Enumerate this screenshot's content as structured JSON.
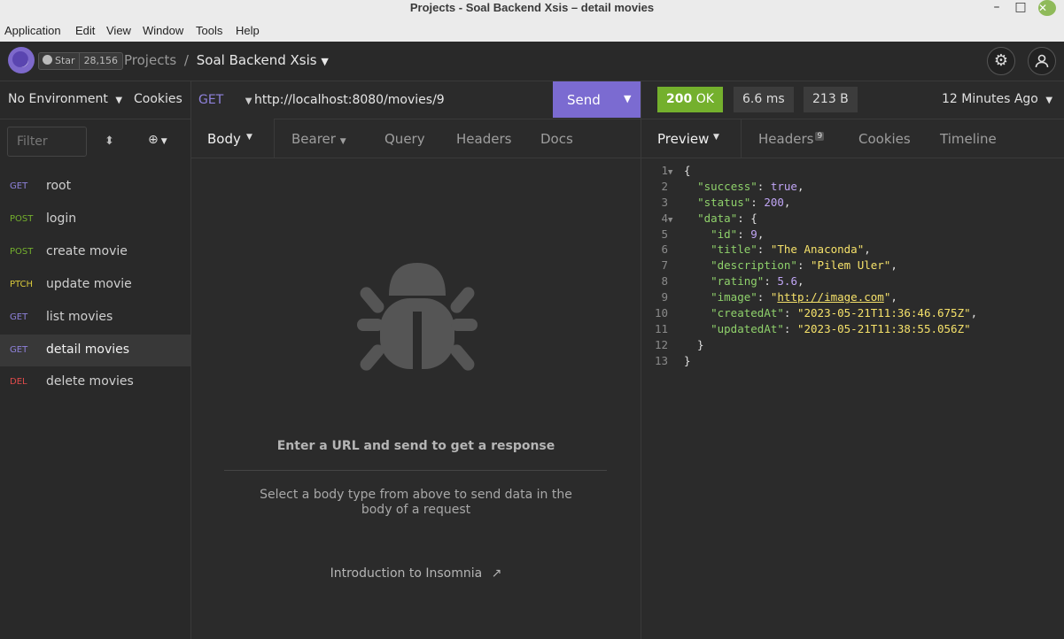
{
  "window": {
    "title": "Projects - Soal Backend Xsis – detail movies",
    "minimize": "–",
    "maximize": "□",
    "close": "✕"
  },
  "menubar": [
    "Application",
    "Edit",
    "View",
    "Window",
    "Tools",
    "Help"
  ],
  "header": {
    "star_label": "Star",
    "star_count": "28,156",
    "breadcrumb_root": "Projects",
    "breadcrumb_sep": "/",
    "project_name": "Soal Backend Xsis",
    "settings_icon": "gear-icon",
    "account_icon": "user-icon"
  },
  "sidebar": {
    "environment": "No Environment",
    "cookies": "Cookies",
    "filter_placeholder": "Filter",
    "requests": [
      {
        "method": "GET",
        "name": "root",
        "color": "#8f82dc"
      },
      {
        "method": "POST",
        "name": "login",
        "color": "#74b02d"
      },
      {
        "method": "POST",
        "name": "create movie",
        "color": "#74b02d"
      },
      {
        "method": "PTCH",
        "name": "update movie",
        "color": "#d9c93a"
      },
      {
        "method": "GET",
        "name": "list movies",
        "color": "#8f82dc"
      },
      {
        "method": "GET",
        "name": "detail movies",
        "color": "#8f82dc",
        "active": true
      },
      {
        "method": "DEL",
        "name": "delete movies",
        "color": "#e04b4b"
      }
    ]
  },
  "request": {
    "method": "GET",
    "url": "http://localhost:8080/movies/9",
    "send": "Send",
    "tabs": [
      "Body",
      "Bearer",
      "Query",
      "Headers",
      "Docs"
    ],
    "empty_title": "Enter a URL and send to get a response",
    "empty_sub": "Select a body type from above to send data in the body of a request",
    "intro_link": "Introduction to Insomnia"
  },
  "response": {
    "status_code": "200",
    "status_text": "OK",
    "time": "6.6 ms",
    "size": "213 B",
    "time_ago": "12 Minutes Ago",
    "tabs": {
      "preview": "Preview",
      "headers": "Headers",
      "headers_count": "9",
      "cookies": "Cookies",
      "timeline": "Timeline"
    }
  },
  "accent_color": "#7b6bd1",
  "status_color": "#74b02d"
}
